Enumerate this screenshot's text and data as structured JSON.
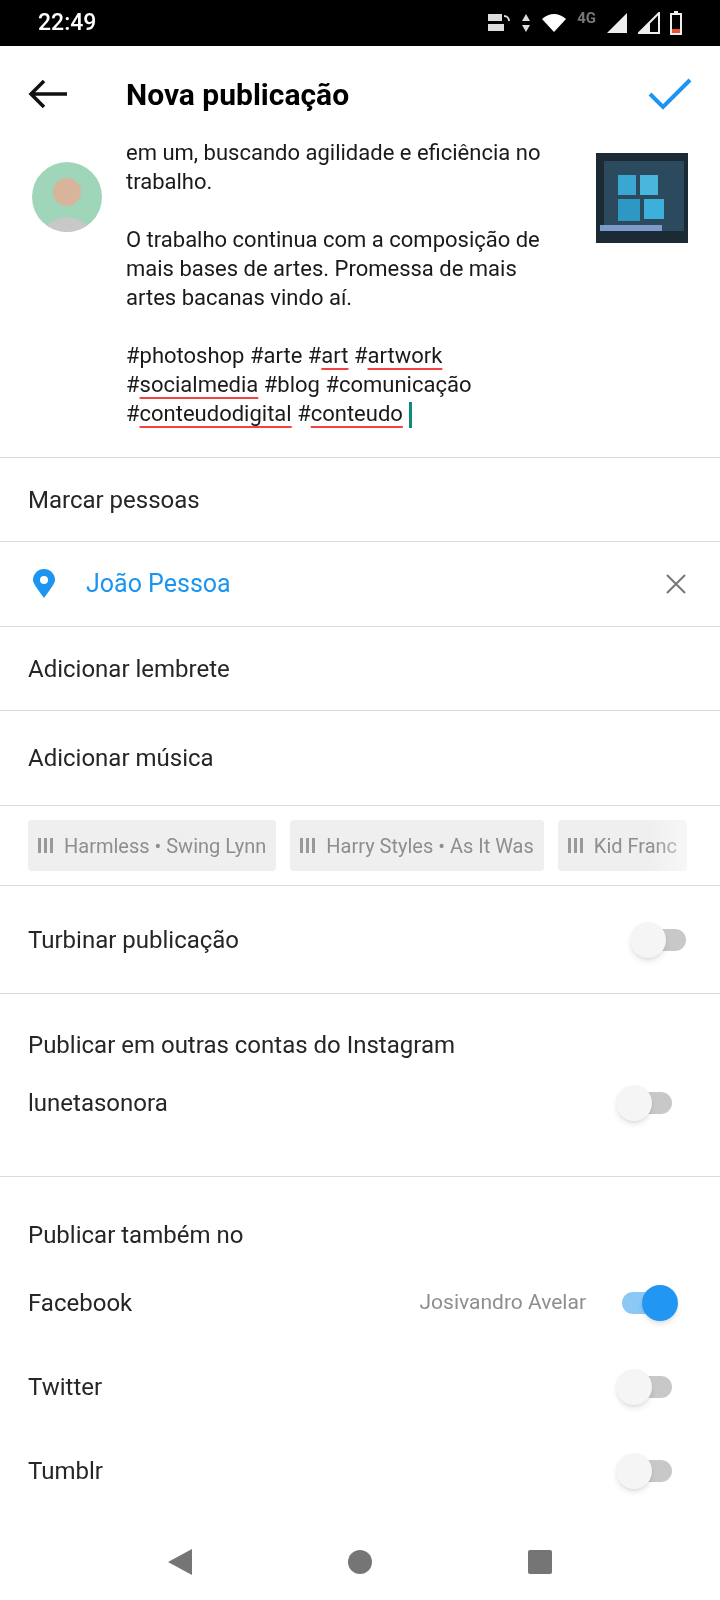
{
  "status_bar": {
    "time": "22:49",
    "network": "4G"
  },
  "header": {
    "title": "Nova publicação"
  },
  "caption": {
    "paragraphs": [
      "em um, buscando agilidade e eficiência no trabalho.",
      "O trabalho continua com a composição de mais bases de artes. Promessa de mais artes bacanas vindo aí."
    ],
    "hashtags": [
      {
        "text": "#photoshop",
        "misspelled": false
      },
      {
        "text": "#arte",
        "misspelled": false
      },
      {
        "text": "#art",
        "misspelled": true
      },
      {
        "text": "#artwork",
        "misspelled": true
      },
      {
        "text": "#socialmedia",
        "misspelled": true
      },
      {
        "text": "#blog",
        "misspelled": false
      },
      {
        "text": "#comunicação",
        "misspelled": false
      },
      {
        "text": "#conteudodigital",
        "misspelled": true
      },
      {
        "text": "#conteudo",
        "misspelled": true
      }
    ]
  },
  "tag_people": {
    "label": "Marcar pessoas"
  },
  "location": {
    "label": "João Pessoa"
  },
  "reminder": {
    "label": "Adicionar lembrete"
  },
  "music": {
    "label": "Adicionar música",
    "suggestions": [
      "Harmless • Swing Lynn",
      "Harry Styles • As It Was",
      "Kid Franc"
    ]
  },
  "boost": {
    "label": "Turbinar publicação",
    "on": false
  },
  "other_accounts": {
    "heading": "Publicar em outras contas do Instagram",
    "accounts": [
      {
        "name": "lunetasonora",
        "on": false
      }
    ]
  },
  "share_also": {
    "heading": "Publicar também no",
    "services": [
      {
        "name": "Facebook",
        "account": "Josivandro Avelar",
        "on": true
      },
      {
        "name": "Twitter",
        "on": false
      },
      {
        "name": "Tumblr",
        "on": false
      }
    ]
  }
}
